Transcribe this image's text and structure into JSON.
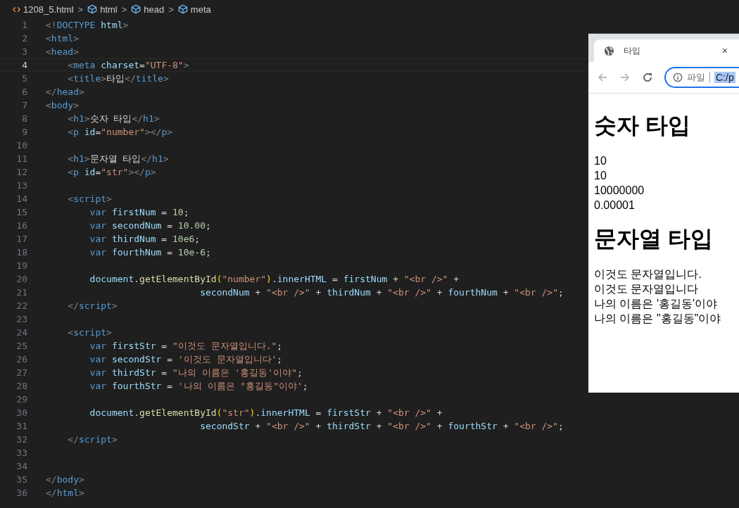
{
  "breadcrumb": [
    {
      "label": "1208_5.html",
      "kind": "file"
    },
    {
      "label": "html",
      "kind": "element"
    },
    {
      "label": "head",
      "kind": "element"
    },
    {
      "label": "meta",
      "kind": "element"
    }
  ],
  "breadcrumb_separator": ">",
  "lines": [
    {
      "n": "1",
      "current": false,
      "tokens": [
        {
          "t": "<!",
          "kind": "p"
        },
        {
          "t": "DOCTYPE",
          "kind": "tag"
        },
        {
          "t": " html",
          "kind": "attr"
        },
        {
          "t": ">",
          "kind": "p"
        }
      ]
    },
    {
      "n": "2",
      "current": false,
      "tokens": [
        {
          "t": "<",
          "kind": "p"
        },
        {
          "t": "html",
          "kind": "tag"
        },
        {
          "t": ">",
          "kind": "p"
        }
      ]
    },
    {
      "n": "3",
      "current": false,
      "tokens": [
        {
          "t": "<",
          "kind": "p"
        },
        {
          "t": "head",
          "kind": "tag"
        },
        {
          "t": ">",
          "kind": "p"
        }
      ]
    },
    {
      "n": "4",
      "current": true,
      "tokens": [
        {
          "t": "    <",
          "kind": "p"
        },
        {
          "t": "meta",
          "kind": "tag"
        },
        {
          "t": " charset",
          "kind": "attr"
        },
        {
          "t": "=",
          "kind": "txt"
        },
        {
          "t": "\"UTF-8\"",
          "kind": "str"
        },
        {
          "t": ">",
          "kind": "p"
        }
      ]
    },
    {
      "n": "5",
      "current": false,
      "tokens": [
        {
          "t": "    <",
          "kind": "p"
        },
        {
          "t": "title",
          "kind": "tag"
        },
        {
          "t": ">",
          "kind": "p"
        },
        {
          "t": "타입",
          "kind": "txt"
        },
        {
          "t": "</",
          "kind": "p"
        },
        {
          "t": "title",
          "kind": "tag"
        },
        {
          "t": ">",
          "kind": "p"
        }
      ]
    },
    {
      "n": "6",
      "current": false,
      "tokens": [
        {
          "t": "</",
          "kind": "p"
        },
        {
          "t": "head",
          "kind": "tag"
        },
        {
          "t": ">",
          "kind": "p"
        }
      ]
    },
    {
      "n": "7",
      "current": false,
      "tokens": [
        {
          "t": "<",
          "kind": "p"
        },
        {
          "t": "body",
          "kind": "tag"
        },
        {
          "t": ">",
          "kind": "p"
        }
      ]
    },
    {
      "n": "8",
      "current": false,
      "tokens": [
        {
          "t": "    <",
          "kind": "p"
        },
        {
          "t": "h1",
          "kind": "tag"
        },
        {
          "t": ">",
          "kind": "p"
        },
        {
          "t": "숫자 타입",
          "kind": "txt"
        },
        {
          "t": "</",
          "kind": "p"
        },
        {
          "t": "h1",
          "kind": "tag"
        },
        {
          "t": ">",
          "kind": "p"
        }
      ]
    },
    {
      "n": "9",
      "current": false,
      "tokens": [
        {
          "t": "    <",
          "kind": "p"
        },
        {
          "t": "p",
          "kind": "tag"
        },
        {
          "t": " id",
          "kind": "attr"
        },
        {
          "t": "=",
          "kind": "txt"
        },
        {
          "t": "\"number\"",
          "kind": "str"
        },
        {
          "t": "></",
          "kind": "p"
        },
        {
          "t": "p",
          "kind": "tag"
        },
        {
          "t": ">",
          "kind": "p"
        }
      ]
    },
    {
      "n": "10",
      "current": false
    },
    {
      "n": "11",
      "current": false,
      "tokens": [
        {
          "t": "    <",
          "kind": "p"
        },
        {
          "t": "h1",
          "kind": "tag"
        },
        {
          "t": ">",
          "kind": "p"
        },
        {
          "t": "문자열 타입",
          "kind": "txt"
        },
        {
          "t": "</",
          "kind": "p"
        },
        {
          "t": "h1",
          "kind": "tag"
        },
        {
          "t": ">",
          "kind": "p"
        }
      ]
    },
    {
      "n": "12",
      "current": false,
      "tokens": [
        {
          "t": "    <",
          "kind": "p"
        },
        {
          "t": "p",
          "kind": "tag"
        },
        {
          "t": " id",
          "kind": "attr"
        },
        {
          "t": "=",
          "kind": "txt"
        },
        {
          "t": "\"str\"",
          "kind": "str"
        },
        {
          "t": "></",
          "kind": "p"
        },
        {
          "t": "p",
          "kind": "tag"
        },
        {
          "t": ">",
          "kind": "p"
        }
      ]
    },
    {
      "n": "13",
      "current": false
    },
    {
      "n": "14",
      "current": false,
      "tokens": [
        {
          "t": "    <",
          "kind": "p"
        },
        {
          "t": "script",
          "kind": "tag"
        },
        {
          "t": ">",
          "kind": "p"
        }
      ]
    },
    {
      "n": "15",
      "current": false,
      "tokens": [
        {
          "t": "        var",
          "kind": "kw"
        },
        {
          "t": " firstNum",
          "kind": "var"
        },
        {
          "t": " = ",
          "kind": "txt"
        },
        {
          "t": "10",
          "kind": "num"
        },
        {
          "t": ";",
          "kind": "txt"
        }
      ]
    },
    {
      "n": "16",
      "current": false,
      "tokens": [
        {
          "t": "        var",
          "kind": "kw"
        },
        {
          "t": " secondNum",
          "kind": "var"
        },
        {
          "t": " = ",
          "kind": "txt"
        },
        {
          "t": "10.00",
          "kind": "num"
        },
        {
          "t": ";",
          "kind": "txt"
        }
      ]
    },
    {
      "n": "17",
      "current": false,
      "tokens": [
        {
          "t": "        var",
          "kind": "kw"
        },
        {
          "t": " thirdNum",
          "kind": "var"
        },
        {
          "t": " = ",
          "kind": "txt"
        },
        {
          "t": "10e6",
          "kind": "num"
        },
        {
          "t": ";",
          "kind": "txt"
        }
      ]
    },
    {
      "n": "18",
      "current": false,
      "tokens": [
        {
          "t": "        var",
          "kind": "kw"
        },
        {
          "t": " fourthNum",
          "kind": "var"
        },
        {
          "t": " = ",
          "kind": "txt"
        },
        {
          "t": "10e-6",
          "kind": "num"
        },
        {
          "t": ";",
          "kind": "txt"
        }
      ]
    },
    {
      "n": "19",
      "current": false
    },
    {
      "n": "20",
      "current": false,
      "tokens": [
        {
          "t": "        document",
          "kind": "var"
        },
        {
          "t": ".",
          "kind": "txt"
        },
        {
          "t": "getElementById",
          "kind": "fn"
        },
        {
          "t": "(",
          "kind": "brk"
        },
        {
          "t": "\"number\"",
          "kind": "str"
        },
        {
          "t": ")",
          "kind": "brk"
        },
        {
          "t": ".",
          "kind": "txt"
        },
        {
          "t": "innerHTML",
          "kind": "var"
        },
        {
          "t": " = ",
          "kind": "txt"
        },
        {
          "t": "firstNum",
          "kind": "var"
        },
        {
          "t": " + ",
          "kind": "txt"
        },
        {
          "t": "\"<br />\"",
          "kind": "str"
        },
        {
          "t": " +",
          "kind": "txt"
        }
      ]
    },
    {
      "n": "21",
      "current": false,
      "tokens": [
        {
          "t": "                            secondNum",
          "kind": "var"
        },
        {
          "t": " + ",
          "kind": "txt"
        },
        {
          "t": "\"<br />\"",
          "kind": "str"
        },
        {
          "t": " + ",
          "kind": "txt"
        },
        {
          "t": "thirdNum",
          "kind": "var"
        },
        {
          "t": " + ",
          "kind": "txt"
        },
        {
          "t": "\"<br />\"",
          "kind": "str"
        },
        {
          "t": " + ",
          "kind": "txt"
        },
        {
          "t": "fourthNum",
          "kind": "var"
        },
        {
          "t": " + ",
          "kind": "txt"
        },
        {
          "t": "\"<br />\"",
          "kind": "str"
        },
        {
          "t": ";",
          "kind": "txt"
        }
      ]
    },
    {
      "n": "22",
      "current": false,
      "tokens": [
        {
          "t": "    </",
          "kind": "p"
        },
        {
          "t": "script",
          "kind": "tag"
        },
        {
          "t": ">",
          "kind": "p"
        }
      ]
    },
    {
      "n": "23",
      "current": false
    },
    {
      "n": "24",
      "current": false,
      "tokens": [
        {
          "t": "    <",
          "kind": "p"
        },
        {
          "t": "script",
          "kind": "tag"
        },
        {
          "t": ">",
          "kind": "p"
        }
      ]
    },
    {
      "n": "25",
      "current": false,
      "tokens": [
        {
          "t": "        var",
          "kind": "kw"
        },
        {
          "t": " firstStr",
          "kind": "var"
        },
        {
          "t": " = ",
          "kind": "txt"
        },
        {
          "t": "\"이것도 문자열입니다.\"",
          "kind": "str"
        },
        {
          "t": ";",
          "kind": "txt"
        }
      ]
    },
    {
      "n": "26",
      "current": false,
      "tokens": [
        {
          "t": "        var",
          "kind": "kw"
        },
        {
          "t": " secondStr",
          "kind": "var"
        },
        {
          "t": " = ",
          "kind": "txt"
        },
        {
          "t": "'이것도 문자열입니다'",
          "kind": "str"
        },
        {
          "t": ";",
          "kind": "txt"
        }
      ]
    },
    {
      "n": "27",
      "current": false,
      "tokens": [
        {
          "t": "        var",
          "kind": "kw"
        },
        {
          "t": " thirdStr",
          "kind": "var"
        },
        {
          "t": " = ",
          "kind": "txt"
        },
        {
          "t": "\"나의 이름은 '홍길동'이야\"",
          "kind": "str"
        },
        {
          "t": ";",
          "kind": "txt"
        }
      ]
    },
    {
      "n": "28",
      "current": false,
      "tokens": [
        {
          "t": "        var",
          "kind": "kw"
        },
        {
          "t": " fourthStr",
          "kind": "var"
        },
        {
          "t": " = ",
          "kind": "txt"
        },
        {
          "t": "'나의 이름은 \"홍길동\"이야'",
          "kind": "str"
        },
        {
          "t": ";",
          "kind": "txt"
        }
      ]
    },
    {
      "n": "29",
      "current": false
    },
    {
      "n": "30",
      "current": false,
      "tokens": [
        {
          "t": "        document",
          "kind": "var"
        },
        {
          "t": ".",
          "kind": "txt"
        },
        {
          "t": "getElementById",
          "kind": "fn"
        },
        {
          "t": "(",
          "kind": "brk"
        },
        {
          "t": "\"str\"",
          "kind": "str"
        },
        {
          "t": ")",
          "kind": "brk"
        },
        {
          "t": ".",
          "kind": "txt"
        },
        {
          "t": "innerHTML",
          "kind": "var"
        },
        {
          "t": " = ",
          "kind": "txt"
        },
        {
          "t": "firstStr",
          "kind": "var"
        },
        {
          "t": " + ",
          "kind": "txt"
        },
        {
          "t": "\"<br />\"",
          "kind": "str"
        },
        {
          "t": " +",
          "kind": "txt"
        }
      ]
    },
    {
      "n": "31",
      "current": false,
      "tokens": [
        {
          "t": "                            secondStr",
          "kind": "var"
        },
        {
          "t": " + ",
          "kind": "txt"
        },
        {
          "t": "\"<br />\"",
          "kind": "str"
        },
        {
          "t": " + ",
          "kind": "txt"
        },
        {
          "t": "thirdStr",
          "kind": "var"
        },
        {
          "t": " + ",
          "kind": "txt"
        },
        {
          "t": "\"<br />\"",
          "kind": "str"
        },
        {
          "t": " + ",
          "kind": "txt"
        },
        {
          "t": "fourthStr",
          "kind": "var"
        },
        {
          "t": " + ",
          "kind": "txt"
        },
        {
          "t": "\"<br />\"",
          "kind": "str"
        },
        {
          "t": ";",
          "kind": "txt"
        }
      ]
    },
    {
      "n": "32",
      "current": false,
      "tokens": [
        {
          "t": "    </",
          "kind": "p"
        },
        {
          "t": "script",
          "kind": "tag"
        },
        {
          "t": ">",
          "kind": "p"
        }
      ]
    },
    {
      "n": "33",
      "current": false
    },
    {
      "n": "34",
      "current": false
    },
    {
      "n": "35",
      "current": false,
      "tokens": [
        {
          "t": "</",
          "kind": "p"
        },
        {
          "t": "body",
          "kind": "tag"
        },
        {
          "t": ">",
          "kind": "p"
        }
      ]
    },
    {
      "n": "36",
      "current": false,
      "tokens": [
        {
          "t": "</",
          "kind": "p"
        },
        {
          "t": "html",
          "kind": "tag"
        },
        {
          "t": ">",
          "kind": "p"
        }
      ]
    }
  ],
  "browser": {
    "tab": {
      "title": "타입",
      "close": "×"
    },
    "address": {
      "scheme": "파일",
      "url": "C:/p",
      "url_selected": true
    },
    "content": [
      {
        "kind": "heading",
        "text": "숫자 타입"
      },
      {
        "kind": "line",
        "text": "10"
      },
      {
        "kind": "line",
        "text": "10"
      },
      {
        "kind": "line",
        "text": "10000000"
      },
      {
        "kind": "line",
        "text": "0.00001"
      },
      {
        "kind": "heading",
        "text": "문자열 타입"
      },
      {
        "kind": "line",
        "text": "이것도 문자열입니다."
      },
      {
        "kind": "line",
        "text": "이것도 문자열입니다"
      },
      {
        "kind": "line",
        "text": "나의 이름은 '홍길동'이야"
      },
      {
        "kind": "line",
        "text": "나의 이름은 \"홍길동\"이야"
      }
    ]
  }
}
